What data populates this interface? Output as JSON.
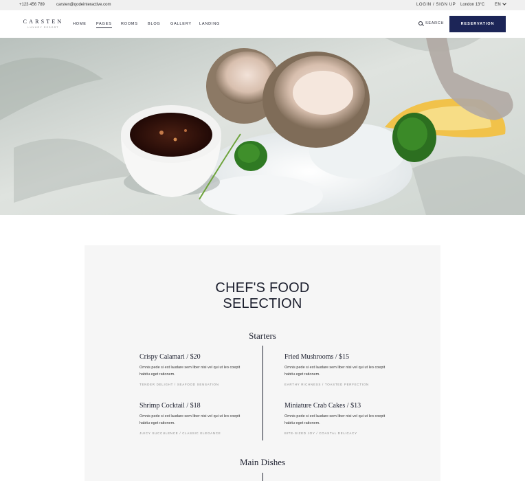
{
  "topbar": {
    "phone": "+123 456 789",
    "email": "carsten@qodeinteractive.com",
    "auth": "LOGIN / SIGN UP",
    "weather": "London  13°C",
    "language": "EN"
  },
  "header": {
    "logo_main": "CARSTEN",
    "logo_sub": "LUXURY RESORT",
    "nav": [
      "HOME",
      "PAGES",
      "ROOMS",
      "BLOG",
      "GALLERY",
      "LANDING"
    ],
    "active_nav": "PAGES",
    "search_label": "SEARCH",
    "reservation_label": "RESERVATION"
  },
  "hero": {
    "subject": "oysters on crushed ice with dipping sauce and lemon"
  },
  "menu": {
    "title_line1": "CHEF'S FOOD",
    "title_line2": "SELECTION",
    "sections": [
      {
        "title": "Starters",
        "dishes": [
          {
            "name": "Crispy Calamari / $20",
            "description": "Omnis pede si est laudare sem liber nisi vel qui ut leo coepit habitu eget rationem.",
            "tags": "TENDER DELIGHT / SEAFOOD SENSATION"
          },
          {
            "name": "Fried Mushrooms / $15",
            "description": "Omnis pede si est laudare sem liber nisi vel qui ut leo coepit habitu eget rationem.",
            "tags": "EARTHY RICHNESS / TOASTED PERFECTION"
          },
          {
            "name": "Shrimp Cocktail / $18",
            "description": "Omnis pede si est laudare sem liber nisi vel qui ut leo coepit habitu eget rationem.",
            "tags": "JUICY SUCCULENCE / CLASSIC ELEGANCE"
          },
          {
            "name": "Miniature Crab Cakes / $13",
            "description": "Omnis pede si est laudare sem liber nisi vel qui ut leo coepit habitu eget rationem.",
            "tags": "BITE-SIZED JOY / COASTAL DELICACY"
          }
        ]
      },
      {
        "title": "Main Dishes",
        "dishes": []
      }
    ]
  },
  "colors": {
    "accent": "#1c2557",
    "text": "#1c1f2e",
    "topbar_bg": "#f0f0f0",
    "card_bg": "#f6f6f6"
  }
}
